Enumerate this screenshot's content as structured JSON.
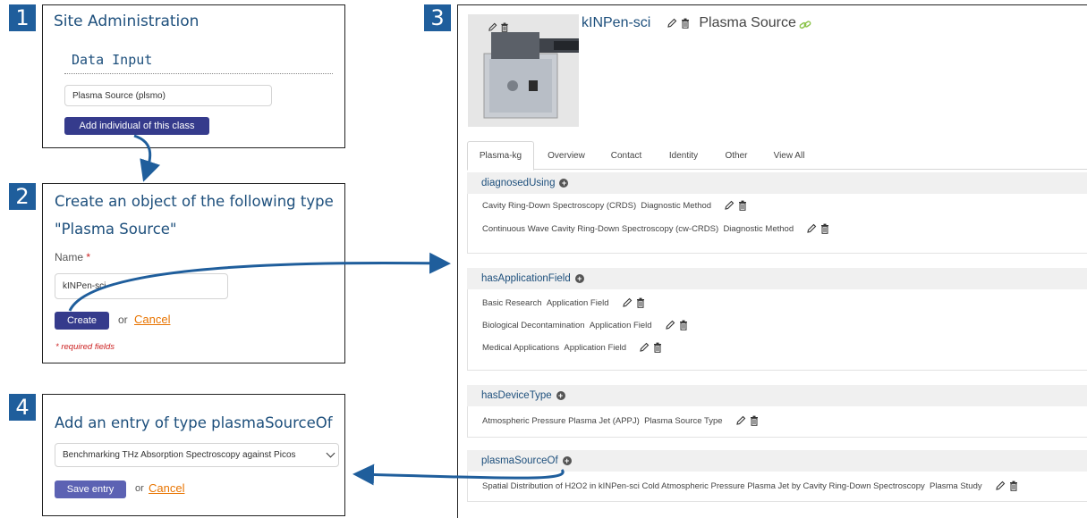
{
  "steps": [
    "1",
    "2",
    "3",
    "4"
  ],
  "panel1": {
    "title": "Site Administration",
    "subtitle": "Data Input",
    "class_select_value": "Plasma Source (plsmo)",
    "add_button_label": "Add individual of this class"
  },
  "panel2": {
    "heading_line1": "Create an object of the following type",
    "heading_line2": "\"Plasma Source\"",
    "name_label": "Name",
    "required_star": "*",
    "name_value": "kINPen-sci",
    "create_button_label": "Create",
    "or_text": "or",
    "cancel_label": "Cancel",
    "required_note": "* required fields"
  },
  "panel3": {
    "entity_name": "kINPen-sci",
    "entity_type": "Plasma Source",
    "tabs": [
      {
        "label": "Plasma-kg",
        "active": true
      },
      {
        "label": "Overview",
        "active": false
      },
      {
        "label": "Contact",
        "active": false
      },
      {
        "label": "Identity",
        "active": false
      },
      {
        "label": "Other",
        "active": false
      },
      {
        "label": "View All",
        "active": false
      }
    ],
    "sections": [
      {
        "name": "diagnosedUsing",
        "rows": [
          {
            "label": "Cavity Ring-Down Spectroscopy (CRDS)",
            "type": "Diagnostic Method"
          },
          {
            "label": "Continuous Wave Cavity Ring-Down Spectroscopy (cw-CRDS)",
            "type": "Diagnostic Method"
          }
        ]
      },
      {
        "name": "hasApplicationField",
        "rows": [
          {
            "label": "Basic Research",
            "type": "Application Field"
          },
          {
            "label": "Biological Decontamination",
            "type": "Application Field"
          },
          {
            "label": "Medical Applications",
            "type": "Application Field"
          }
        ]
      },
      {
        "name": "hasDeviceType",
        "rows": [
          {
            "label": "Atmospheric Pressure Plasma Jet (APPJ)",
            "type": "Plasma Source Type"
          }
        ]
      },
      {
        "name": "plasmaSourceOf",
        "rows": [
          {
            "label": "Spatial Distribution of H2O2 in kINPen-sci Cold Atmospheric Pressure Plasma Jet by Cavity Ring-Down Spectroscopy",
            "type": "Plasma Study"
          }
        ]
      }
    ]
  },
  "panel4": {
    "heading": "Add an entry of type plasmaSourceOf",
    "select_value": "Benchmarking THz Absorption Spectroscopy against Picos",
    "save_button_label": "Save entry",
    "or_text": "or",
    "cancel_label": "Cancel"
  },
  "colors": {
    "step_badge": "#1f5e9c",
    "title_blue": "#1d4f7c",
    "button_navy": "#353b8c",
    "button_periwinkle": "#5c62b3",
    "cancel_orange": "#e87400",
    "required_red": "#cc2222",
    "arrow_blue": "#1f5e9c",
    "link_green": "#8bc34a"
  },
  "icons": [
    "pencil-icon",
    "trash-icon",
    "plus-circle-icon",
    "link-icon",
    "chevron-down-icon",
    "flow-arrow-icon"
  ]
}
